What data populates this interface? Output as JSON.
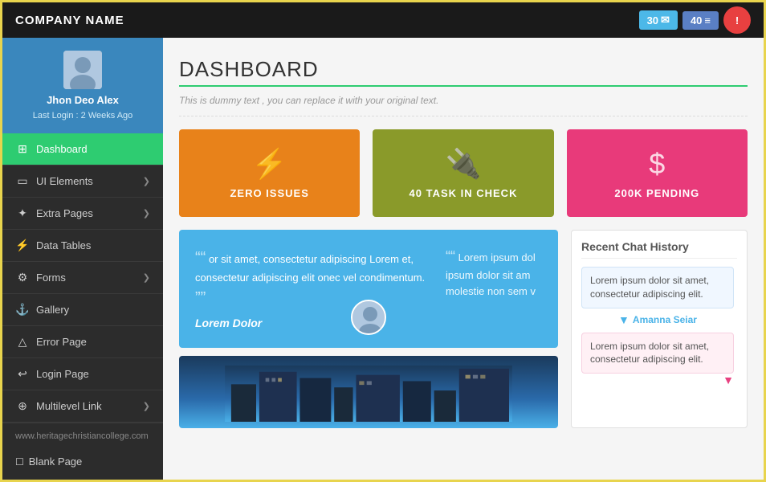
{
  "topnav": {
    "company": "COMPANY NAME",
    "mail_count": "30",
    "list_count": "40",
    "mail_icon": "✉",
    "list_icon": "≡",
    "alert_icon": "!"
  },
  "sidebar": {
    "user_name": "Jhon Deo Alex",
    "user_last_login": "Last Login : 2 Weeks Ago",
    "nav_items": [
      {
        "label": "Dashboard",
        "icon": "⊞",
        "active": true,
        "has_chevron": false
      },
      {
        "label": "UI Elements",
        "icon": "▭",
        "active": false,
        "has_chevron": true
      },
      {
        "label": "Extra Pages",
        "icon": "✦",
        "active": false,
        "has_chevron": true
      },
      {
        "label": "Data Tables",
        "icon": "⚡",
        "active": false,
        "has_chevron": false
      },
      {
        "label": "Forms",
        "icon": "⚙",
        "active": false,
        "has_chevron": true
      },
      {
        "label": "Gallery",
        "icon": "⚓",
        "active": false,
        "has_chevron": false
      },
      {
        "label": "Error Page",
        "icon": "△",
        "active": false,
        "has_chevron": false
      },
      {
        "label": "Login Page",
        "icon": "↩",
        "active": false,
        "has_chevron": false
      },
      {
        "label": "Multilevel Link",
        "icon": "⊕",
        "active": false,
        "has_chevron": true
      }
    ],
    "footer_url": "www.heritagechristiancollege.com",
    "blank_page": "Blank Page"
  },
  "main": {
    "title": "DASHBOARD",
    "subtitle": "This is dummy text , you can replace it with your original text.",
    "stat_cards": [
      {
        "label": "ZERO ISSUES",
        "icon": "⚡",
        "color": "orange"
      },
      {
        "label": "40 TASK IN CHECK",
        "icon": "🔌",
        "color": "olive"
      },
      {
        "label": "200K PENDING",
        "icon": "$",
        "color": "pink"
      }
    ],
    "testimonial": {
      "left_text": "or sit amet, consectetur adipiscing Lorem et, consectetur adipiscing elit onec vel condimentum.",
      "right_text": "Lorem ipsum dol ipsum dolor sit am molestie non sem v",
      "name": "Lorem Dolor",
      "quote_open": "““",
      "quote_close": "””"
    },
    "chat_history": {
      "title": "Recent Chat History",
      "messages": [
        {
          "text": "Lorem ipsum dolor sit amet, consectetur adipiscing elit.",
          "type": "received"
        },
        {
          "sender": "Amanna Seiar",
          "type": "sender"
        },
        {
          "text": "Lorem ipsum dolor sit amet, consectetur adipiscing elit.",
          "type": "sent"
        }
      ]
    }
  }
}
